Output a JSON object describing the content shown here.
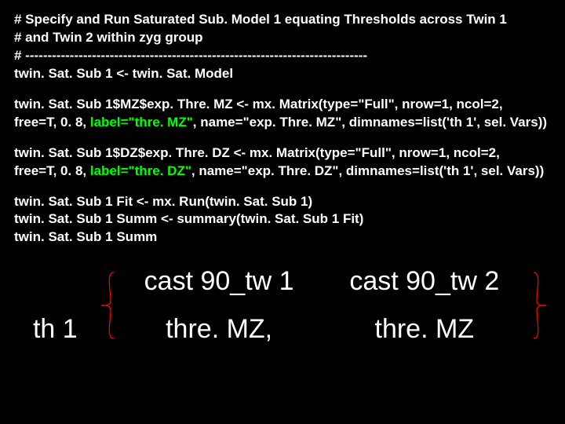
{
  "code": {
    "l1": "# Specify and Run Saturated Sub. Model 1 equating Thresholds across Twin 1",
    "l2": "# and Twin 2 within zyg group",
    "l3": "# -----------------------------------------------------------------------------",
    "l4": "twin. Sat. Sub 1 <- twin. Sat. Model",
    "l5a": "twin. Sat. Sub 1$MZ$exp. Thre. MZ <- mx. Matrix(type=\"Full\", nrow=1, ncol=2,",
    "l5b_pre": "free=T, 0. 8, ",
    "l5b_label": "label=\"thre. MZ\"",
    "l5b_post": ", name=\"exp. Thre. MZ\", dimnames=list('th 1', sel. Vars))",
    "l6a": "twin. Sat. Sub 1$DZ$exp. Thre. DZ <- mx. Matrix(type=\"Full\", nrow=1, ncol=2,",
    "l6b_pre": "free=T, 0. 8, ",
    "l6b_label": "label=\"thre. DZ\"",
    "l6b_post": ", name=\"exp. Thre. DZ\", dimnames=list('th 1', sel. Vars))",
    "l7": "twin. Sat. Sub 1 Fit <- mx. Run(twin. Sat. Sub 1)",
    "l8": "twin. Sat. Sub 1 Summ <- summary(twin. Sat. Sub 1 Fit)",
    "l9": "twin. Sat. Sub 1 Summ"
  },
  "diagram": {
    "row_label": "th 1",
    "col1_header": "cast 90_tw 1",
    "col2_header": "cast 90_tw 2",
    "col1_value": "thre. MZ,",
    "col2_value": "thre. MZ"
  }
}
